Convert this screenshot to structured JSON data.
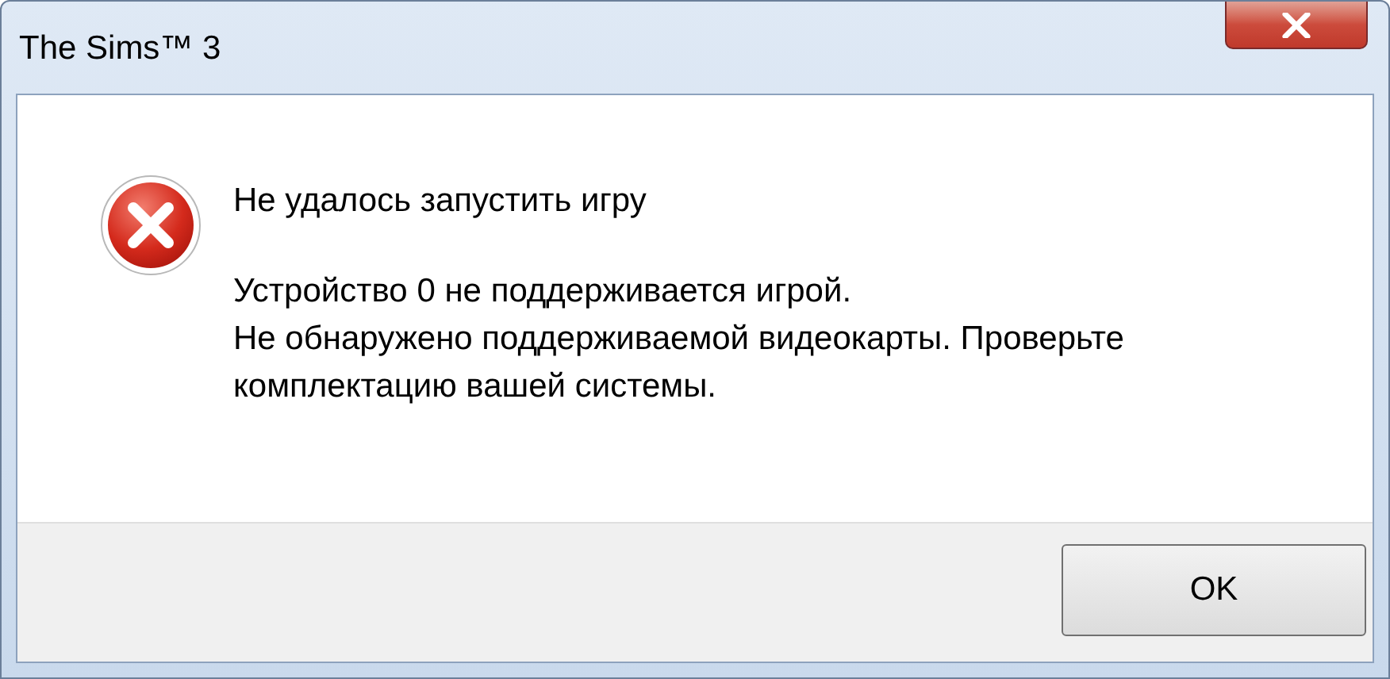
{
  "window": {
    "title": "The Sims™ 3"
  },
  "message": {
    "heading": "Не удалось запустить игру",
    "paragraphs": [
      "Устройство 0 не поддерживается игрой.",
      "Не обнаружено поддерживаемой видеокарты. Проверьте комплектацию вашей системы."
    ]
  },
  "buttons": [
    {
      "label": "OK"
    }
  ]
}
